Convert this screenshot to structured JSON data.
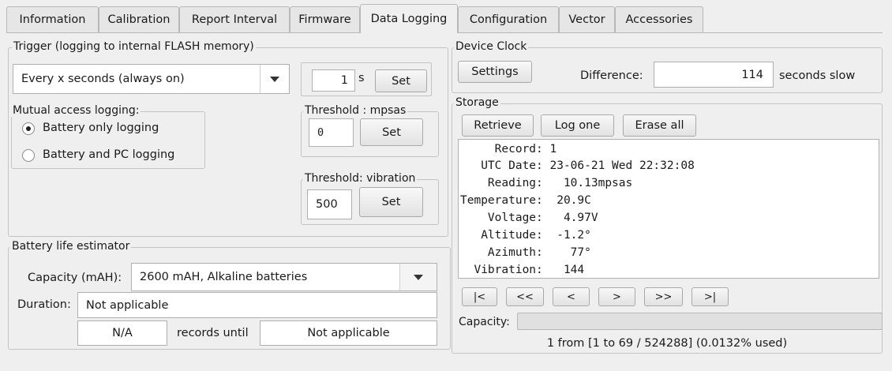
{
  "tabs": [
    "Information",
    "Calibration",
    "Report Interval",
    "Firmware",
    "Data Logging",
    "Configuration",
    "Vector",
    "Accessories"
  ],
  "trigger": {
    "title": "Trigger (logging to internal FLASH memory)",
    "mode": "Every x seconds (always on)",
    "interval_value": "1",
    "interval_unit": "s",
    "set_label": "Set"
  },
  "mutual": {
    "title": "Mutual access logging:",
    "options": [
      "Battery only logging",
      "Battery and PC logging"
    ],
    "selected": 0
  },
  "threshold_mpsas": {
    "title": "Threshold : mpsas",
    "value": "0",
    "set_label": "Set"
  },
  "threshold_vibration": {
    "title": "Threshold: vibration",
    "value": "500",
    "set_label": "Set"
  },
  "battery": {
    "title": "Battery life estimator",
    "capacity_label": "Capacity (mAH):",
    "capacity_value": "2600 mAH, Alkaline batteries",
    "duration_label": "Duration:",
    "duration_value": "Not applicable",
    "records_value": "N/A",
    "records_label": "records until",
    "until_value": "Not applicable"
  },
  "clock": {
    "title": "Device Clock",
    "settings_label": "Settings",
    "difference_label": "Difference:",
    "difference_value": "114",
    "difference_suffix": "seconds slow"
  },
  "storage": {
    "title": "Storage",
    "retrieve_label": "Retrieve",
    "logone_label": "Log one",
    "erase_label": "Erase all",
    "record_lines": [
      "     Record: 1",
      "   UTC Date: 23-06-21 Wed 22:32:08",
      "    Reading:   10.13mpsas",
      "Temperature:  20.9C",
      "    Voltage:   4.97V",
      "   Altitude:  -1.2°",
      "    Azimuth:    77°",
      "  Vibration:   144"
    ],
    "nav_buttons": [
      "|<",
      "<<",
      "<",
      ">",
      ">>",
      ">|"
    ],
    "capacity_label": "Capacity:",
    "capacity_fraction": 0.000132,
    "status": "1 from [1 to 69 / 524288] (0.0132% used)"
  }
}
